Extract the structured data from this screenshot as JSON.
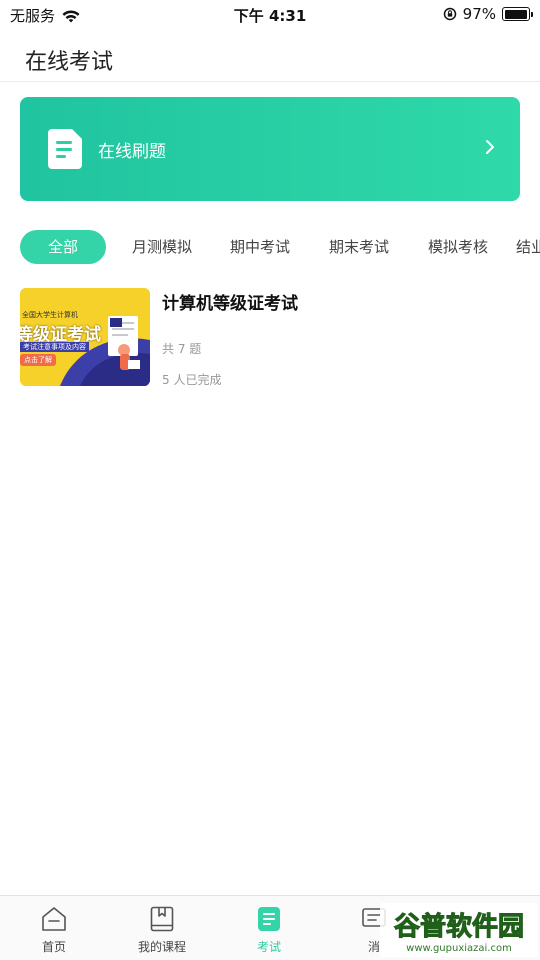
{
  "status_bar": {
    "carrier": "无服务",
    "time": "下午 4:31",
    "battery": "97%",
    "battery_level": 0.97
  },
  "header": {
    "title": "在线考试"
  },
  "banner": {
    "label": "在线刷题",
    "icon": "document-icon",
    "colors": {
      "start": "#20c4a0",
      "end": "#2fd9a8"
    }
  },
  "tabs": [
    {
      "label": "全部",
      "active": true
    },
    {
      "label": "月测模拟",
      "active": false
    },
    {
      "label": "期中考试",
      "active": false
    },
    {
      "label": "期末考试",
      "active": false
    },
    {
      "label": "模拟考核",
      "active": false
    },
    {
      "label": "结业",
      "active": false
    }
  ],
  "exam_list": [
    {
      "title": "计算机等级证考试",
      "count": "共 7 题",
      "completed": "5 人已完成",
      "thumbnail": {
        "subtitle": "全国大学生计算机",
        "headline": "等级证考试",
        "note": "考试注意事项及内容",
        "cta": "点击了解"
      }
    }
  ],
  "bottom_nav": [
    {
      "label": "首页",
      "icon": "home-icon",
      "active": false
    },
    {
      "label": "我的课程",
      "icon": "book-icon",
      "active": false
    },
    {
      "label": "考试",
      "icon": "exam-icon",
      "active": true
    },
    {
      "label": "消",
      "icon": "message-icon",
      "active": false
    }
  ],
  "watermark": {
    "brand": "谷普软件园",
    "url": "www.gupuxiazai.com"
  },
  "colors": {
    "accent": "#34d4a8",
    "text_primary": "#111111",
    "text_muted": "#999999"
  }
}
